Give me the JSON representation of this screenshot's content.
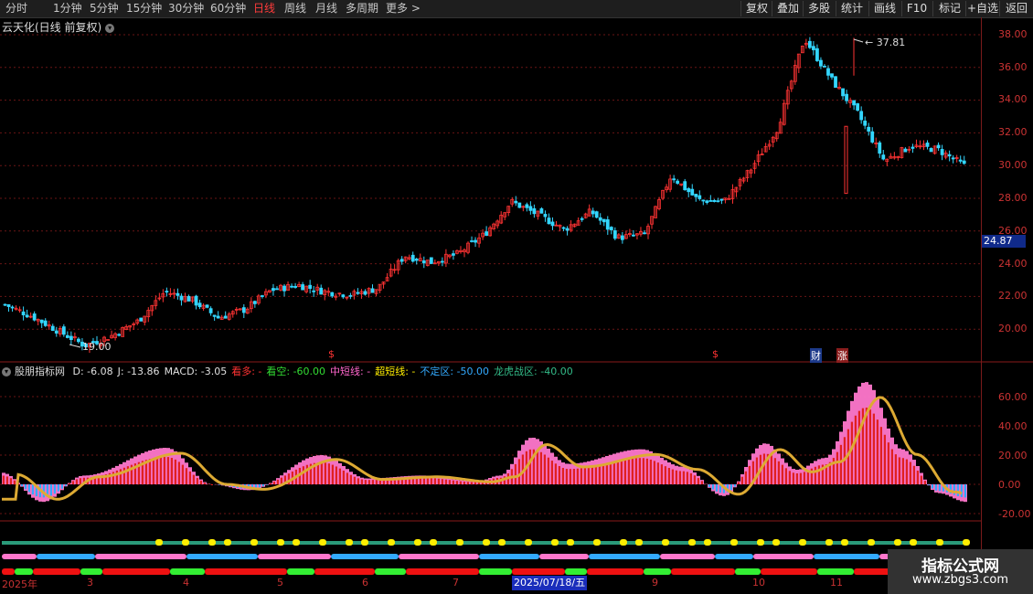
{
  "toolbar": {
    "periods": [
      "分时",
      "1分钟",
      "5分钟",
      "15分钟",
      "30分钟",
      "60分钟",
      "日线",
      "周线",
      "月线",
      "多周期",
      "更多 >"
    ],
    "active_period": "日线",
    "right_buttons": [
      "复权",
      "叠加",
      "多股",
      "统计",
      "画线",
      "F10",
      "+自选",
      "标记",
      "返回"
    ]
  },
  "title": "云天化(日线 前复权)",
  "indicator": {
    "name": "股朋指标网",
    "items": [
      {
        "label": "D: -6.08",
        "color": "#e0e0e0"
      },
      {
        "label": "J: -13.86",
        "color": "#e0e0e0"
      },
      {
        "label": "MACD: -3.05",
        "color": "#e0e0e0"
      },
      {
        "label": "看多: -",
        "color": "#ff3333"
      },
      {
        "label": "看空: -60.00",
        "color": "#33dd33"
      },
      {
        "label": "中短线: -",
        "color": "#ff66cc"
      },
      {
        "label": "超短线: -",
        "color": "#ffee00"
      },
      {
        "label": "不定区: -50.00",
        "color": "#33aaff"
      },
      {
        "label": "龙虎战区: -40.00",
        "color": "#33bb88"
      }
    ]
  },
  "price_axis": [
    "38.00",
    "36.00",
    "34.00",
    "32.00",
    "30.00",
    "28.00",
    "26.00",
    "24.00",
    "22.00",
    "20.00"
  ],
  "current_price": "24.87",
  "indicator_axis": [
    "60.00",
    "40.00",
    "20.00",
    "0.00",
    "-20.00"
  ],
  "annotations": {
    "high": "37.81",
    "low": "19.00"
  },
  "events": [
    {
      "label": "$",
      "color": "#ff3333"
    },
    {
      "label": "$",
      "color": "#ff3333"
    },
    {
      "label": "财",
      "color": "#3b82ff"
    },
    {
      "label": "涨",
      "color": "#ff3333"
    }
  ],
  "months": [
    "2025年",
    "3",
    "4",
    "5",
    "6",
    "7",
    "9",
    "10",
    "11"
  ],
  "selected_date": "2025/07/18/五",
  "watermark": {
    "line1": "指标公式网",
    "line2": "www.zbgs3.com"
  },
  "colors": {
    "up": "#ff3333",
    "down": "#33d6ff",
    "grid": "#6a1515",
    "pink": "#ff77cc",
    "gold": "#ddaa33",
    "blue": "#33aaff",
    "green": "#33ee33"
  },
  "chart_data": {
    "type": "candlestick",
    "title": "云天化(日线 前复权)",
    "ylim": [
      18.5,
      39
    ],
    "x": [
      "2025年",
      "3",
      "4",
      "5",
      "6",
      "7",
      "9",
      "10",
      "11"
    ],
    "close_approx": [
      21.5,
      20.8,
      19.9,
      19.0,
      19.6,
      20.5,
      22.3,
      21.8,
      20.7,
      21.2,
      22.4,
      22.7,
      22.3,
      22.1,
      22.5,
      24.5,
      24.1,
      24.6,
      25.8,
      27.8,
      27.0,
      26.1,
      27.2,
      25.6,
      25.8,
      29.4,
      27.9,
      27.8,
      29.8,
      32.3,
      37.8,
      35.3,
      33.2,
      30.3,
      31.2,
      31.0,
      30.0
    ]
  }
}
